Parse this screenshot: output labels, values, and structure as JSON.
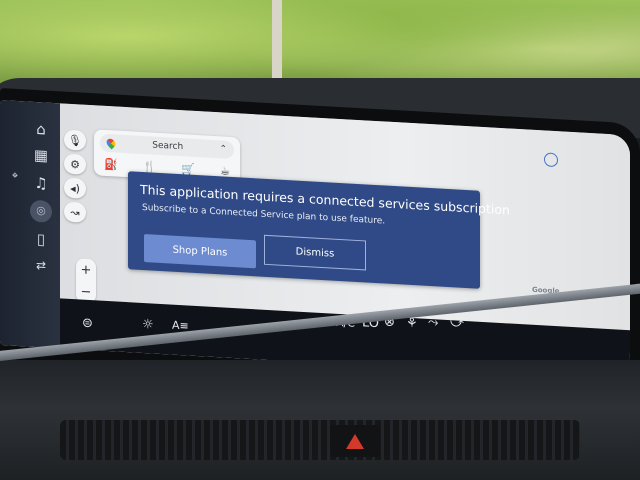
{
  "search": {
    "label": "Search"
  },
  "dialog": {
    "title": "This application requires a connected services subscription",
    "subtitle": "Subscribe to a Connected Service plan to use feature.",
    "primary_label": "Shop Plans",
    "secondary_label": "Dismiss"
  },
  "map": {
    "attribution": "Google"
  },
  "zoom": {
    "in_label": "+",
    "out_label": "−"
  },
  "climate": {
    "ac_label": "A/C",
    "temp_label": "LO"
  },
  "colors": {
    "dialog_bg": "#2f4a86",
    "primary_button": "#6c8bd1",
    "hazard": "#d33a2c"
  }
}
